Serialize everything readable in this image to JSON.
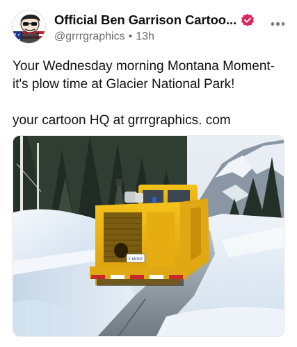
{
  "post": {
    "author": {
      "display_name": "Official  Ben Garrison Cartoo...",
      "handle": "@grrrgraphics",
      "separator": "•",
      "time_ago": "13h",
      "verified": true,
      "verified_color": "#e0245e"
    },
    "text": {
      "line1": "Your Wednesday morning Montana Moment-it's plow time at Glacier National Park!",
      "line2": "your cartoon HQ at grrrgraphics. com"
    },
    "media": {
      "type": "photo",
      "plate_text": "Y MONT"
    },
    "icons": {
      "more": "more-horizontal-icon",
      "verified": "verified-badge-icon"
    }
  }
}
